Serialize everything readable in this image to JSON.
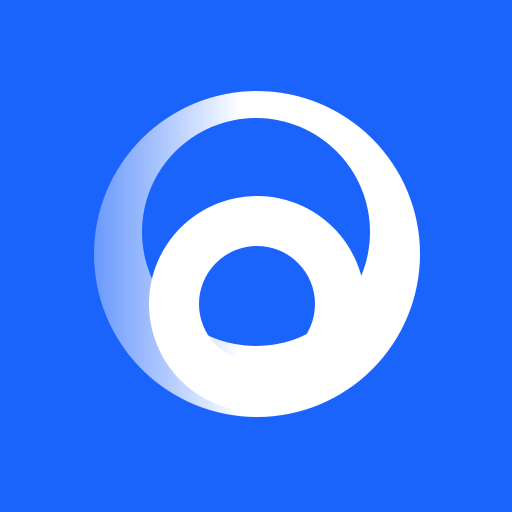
{
  "app_icon": {
    "name": "app-logo",
    "icon": "nested-rings-logo",
    "colors": {
      "background": "#1a63fb",
      "ring": "#ffffff"
    }
  }
}
